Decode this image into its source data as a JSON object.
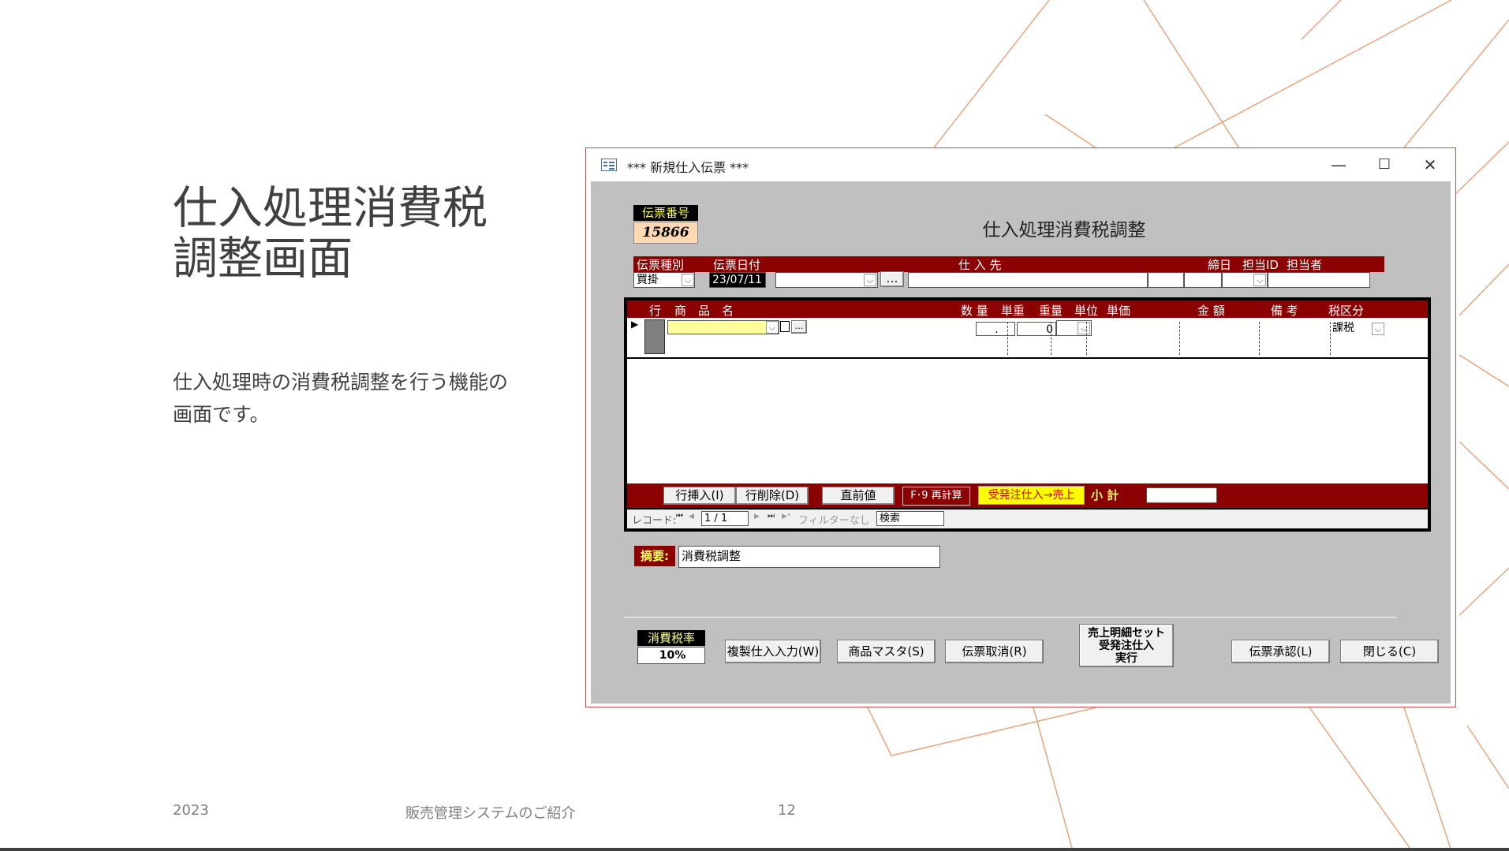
{
  "slide": {
    "title_line1": "仕入処理消費税",
    "title_line2": "調整画面",
    "description_line1": "仕入処理時の消費税調整を行う機能の",
    "description_line2": "画面です。",
    "footer_year": "2023",
    "footer_center": "販売管理システムのご紹介",
    "page_number": "12"
  },
  "window": {
    "title": "*** 新規仕入伝票 ***",
    "minimize": "—",
    "maximize": "☐",
    "close": "✕"
  },
  "form": {
    "heading": "仕入処理消費税調整",
    "slip_number_label": "伝票番号",
    "slip_number": "15866",
    "headers": {
      "slip_type": "伝票種別",
      "slip_date": "伝票日付",
      "supplier": "仕 入 先",
      "closing_day": "締日",
      "staff_id": "担当ID",
      "staff": "担当者"
    },
    "slip_type_value": "買掛",
    "slip_date_value": "23/07/11",
    "supplier_lookup": "…",
    "detail_headers": {
      "row": "行",
      "product": "商　品　名",
      "quantity": "数 量",
      "unit_weight": "単重",
      "weight": "重量",
      "unit": "単位",
      "unit_price": "単価",
      "amount": "金 額",
      "note": "備 考",
      "tax_class": "税区分"
    },
    "row_marker": "▶",
    "product_lookup": "…",
    "qty_value": ".",
    "weight_value": "0",
    "tax_class_value": "課税",
    "buttons": {
      "insert_row": "行挿入(I)",
      "delete_row": "行削除(D)",
      "previous_value": "直前値",
      "recalc": "F･9 再計算",
      "order_to_sales": "受発注仕入→売上",
      "subtotal_label": "小 計"
    },
    "nav": {
      "record_label": "レコード:",
      "first": "⏮",
      "prev": "◀",
      "position": "1 / 1",
      "next": "▶",
      "last": "⏭",
      "new": "▶*",
      "filter": "フィルターなし",
      "search": "検索"
    },
    "summary_label": "摘要:",
    "summary_value": "消費税調整",
    "tax_rate_label": "消費税率",
    "tax_rate_value": "10%",
    "bottom_buttons": {
      "copy_input": "複製仕入入力(W)",
      "product_master": "商品マスタ(S)",
      "cancel_slip": "伝票取消(R)",
      "sales_set_l1": "売上明細セット",
      "sales_set_l2": "受発注仕入",
      "sales_set_l3": "実行",
      "approve": "伝票承認(L)",
      "close": "閉じる(C)"
    }
  }
}
